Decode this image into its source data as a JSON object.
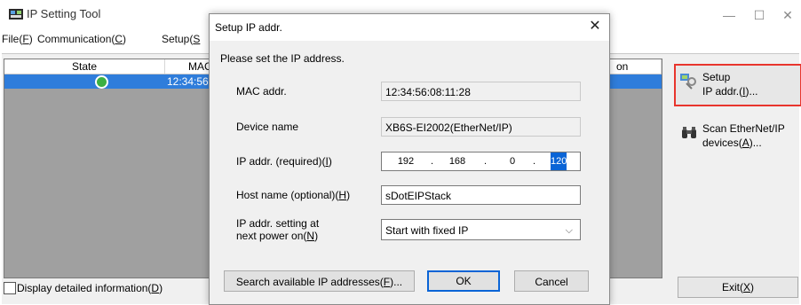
{
  "app": {
    "title": "IP Setting Tool"
  },
  "window_controls": {
    "minimize": "—",
    "maximize": "☐",
    "close": "✕"
  },
  "menu": {
    "file": "File(",
    "file_key": "F",
    "file_end": ")",
    "comm": "Communication(",
    "comm_key": "C",
    "comm_end": ")",
    "setup": "Setup(",
    "setup_key": "S"
  },
  "device_list": {
    "columns": [
      "State",
      "MAC",
      "on"
    ],
    "rows": [
      {
        "state": "ok",
        "mac": "12:34:56"
      }
    ]
  },
  "detail": {
    "label": "Display detailed information(",
    "key": "D",
    "end": ")"
  },
  "side_buttons": {
    "setup_line1": "Setup",
    "setup_line2": "IP addr.(",
    "setup_key": "I",
    "setup_end": ")...",
    "scan_line1": "Scan EtherNet/IP",
    "scan_line2": "devices(",
    "scan_key": "A",
    "scan_end": ")...",
    "exit": "Exit(",
    "exit_key": "X",
    "exit_end": ")"
  },
  "dialog": {
    "title": "Setup IP addr.",
    "close": "✕",
    "instruction": "Please set the IP address.",
    "mac_label": "MAC addr.",
    "mac_value": "12:34:56:08:11:28",
    "device_label": "Device name",
    "device_value": "XB6S-EI2002(EtherNet/IP)",
    "ip_label": "IP addr. (required)(",
    "ip_key": "I",
    "ip_end": ")",
    "ip": [
      "192",
      "168",
      "0",
      "120"
    ],
    "host_label": "Host name (optional)(",
    "host_key": "H",
    "host_end": ")",
    "host_value": "sDotEIPStack",
    "next_label1": "IP addr. setting at",
    "next_label2": "next power on(",
    "next_key": "N",
    "next_end": ")",
    "next_value": "Start with fixed IP",
    "search_btn": "Search available IP addresses(",
    "search_key": "F",
    "search_end": ")...",
    "ok": "OK",
    "cancel": "Cancel"
  }
}
